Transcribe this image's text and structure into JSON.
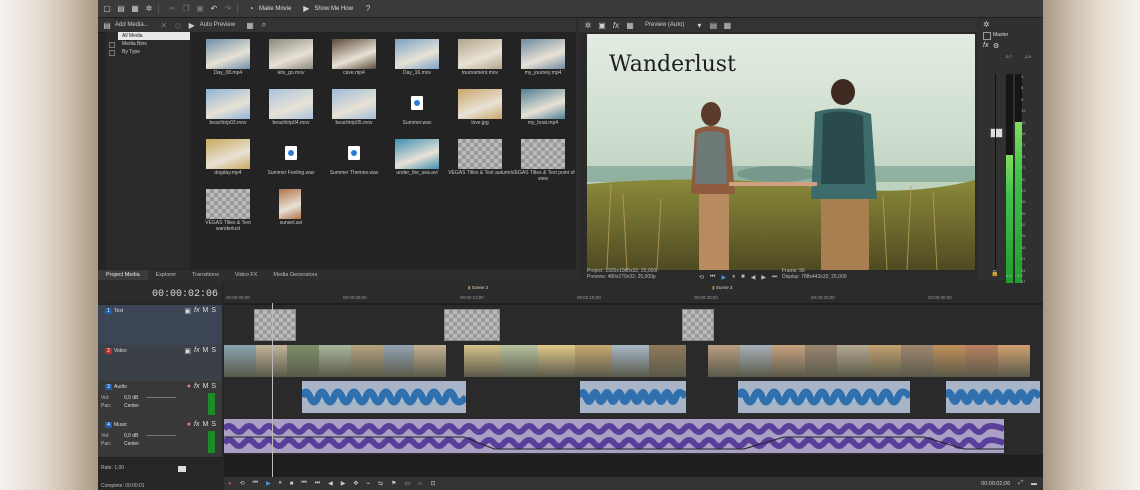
{
  "toolbar": {
    "make_movie": "Make Movie",
    "show_me_how": "Show Me How"
  },
  "media": {
    "add_media": "Add Media...",
    "auto_preview": "Auto Preview",
    "tree": [
      "All Media",
      "Media Bins",
      "By Type"
    ],
    "items": [
      {
        "name": "Day_08.mp4",
        "kind": "video",
        "color": "#6d8fa8"
      },
      {
        "name": "lets_go.mov",
        "kind": "video",
        "color": "#8a8a7c"
      },
      {
        "name": "cave.mp4",
        "kind": "video",
        "color": "#5b4a3a"
      },
      {
        "name": "Day_16.mov",
        "kind": "video",
        "color": "#7aa2c6"
      },
      {
        "name": "tournament.mov",
        "kind": "video",
        "color": "#b4a58b"
      },
      {
        "name": "my_journey.mp4",
        "kind": "video",
        "color": "#6e8aa0"
      },
      {
        "name": "beachtrip03.mov",
        "kind": "video",
        "color": "#8fb3d6"
      },
      {
        "name": "beachtrip04.mov",
        "kind": "video",
        "color": "#a9c3dd"
      },
      {
        "name": "beachtrip05.mov",
        "kind": "video",
        "color": "#9fbcd8"
      },
      {
        "name": "Summer.wav",
        "kind": "audio"
      },
      {
        "name": "love.jpg",
        "kind": "video",
        "color": "#c9a56a"
      },
      {
        "name": "my_boat.mp4",
        "kind": "video",
        "color": "#4f7e93"
      },
      {
        "name": "dogday.mp4",
        "kind": "video",
        "color": "#c9a85d"
      },
      {
        "name": "Summer Feeling.wav",
        "kind": "audio"
      },
      {
        "name": "Summer Themes.wav",
        "kind": "audio"
      },
      {
        "name": "under_the_sea.avi",
        "kind": "video",
        "color": "#3e8fb3"
      },
      {
        "name": "VEGAS Titles & Text autumn",
        "kind": "title"
      },
      {
        "name": "VEGAS Titles & Text point of view",
        "kind": "title"
      },
      {
        "name": "VEGAS Titles & Text wanderlust",
        "kind": "title"
      },
      {
        "name": "sunset.avi",
        "kind": "video",
        "color": "#b0744a"
      }
    ],
    "tabs": [
      "Project Media",
      "Explorer",
      "Transitions",
      "Video FX",
      "Media Generators"
    ]
  },
  "preview": {
    "mode": "Preview (Auto)",
    "title_text": "Wanderlust",
    "project_label": "Project:",
    "project_value": "1920x1080x32; 25,000i",
    "preview_label": "Preview:",
    "preview_value": "480x270x32; 25,000p",
    "frame_label": "Frame:",
    "frame_value": "56",
    "display_label": "Display:",
    "display_value": "788x443x32; 25,000"
  },
  "master": {
    "label": "Master",
    "left_peak": "-5.7",
    "right_peak": "-2.9",
    "scale": [
      "3",
      "6",
      "9",
      "12",
      "15",
      "18",
      "21",
      "24",
      "27",
      "30",
      "33",
      "36",
      "39",
      "42",
      "45",
      "48",
      "51",
      "54",
      "57"
    ],
    "foot_left": "0.0",
    "foot_right": "0.0",
    "level_left": 0.63,
    "level_right": 0.78
  },
  "timeline": {
    "timecode": "00:00:02:06",
    "ruler": [
      "00:00:00;00",
      "00:00:05;00",
      "00:00:10;00",
      "00:00:15;00",
      "00:00:20;00",
      "00:00:25;00",
      "00:00:30;00"
    ],
    "markers": [
      {
        "label": "Scene 2",
        "pos": 0.298
      },
      {
        "label": "Scene 3",
        "pos": 0.596
      }
    ],
    "tracks": [
      {
        "num": "1",
        "name": "Text",
        "type": "text"
      },
      {
        "num": "2",
        "name": "Video",
        "type": "video"
      },
      {
        "num": "3",
        "name": "Audio",
        "type": "audio",
        "vol_label": "Vol:",
        "vol": "0,0 dB",
        "pan_label": "Pan:",
        "pan": "Center"
      },
      {
        "num": "4",
        "name": "Music",
        "type": "audio",
        "vol_label": "Vol:",
        "vol": "0,0 dB",
        "pan_label": "Pan:",
        "pan": "Center"
      }
    ],
    "rate_label": "Rate: 1,00",
    "status": "Complete: 00:00:01",
    "end_time": "00:00:02;06"
  }
}
